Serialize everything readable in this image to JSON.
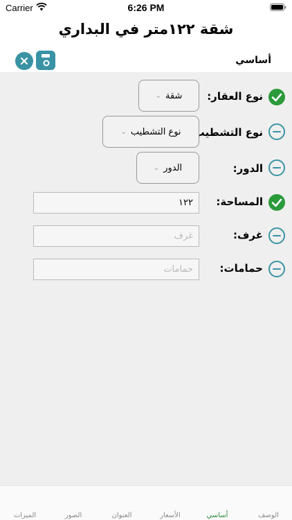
{
  "status": {
    "carrier": "Carrier",
    "time": "6:26 PM"
  },
  "title": "شقة ١٢٢متر في البداري",
  "toolbar": {
    "section_label": "أساسي"
  },
  "form": {
    "property_type": {
      "label": "نوع العقار:",
      "value": "شقة",
      "state": "ok"
    },
    "finishing_type": {
      "label": "نوع التشطيب:",
      "value": "نوع التشطيب",
      "state": "todo"
    },
    "floor": {
      "label": "الدور:",
      "value": "الدور",
      "state": "todo"
    },
    "area": {
      "label": "المساحة:",
      "value": "١٢٢",
      "state": "ok"
    },
    "rooms": {
      "label": "غرف:",
      "placeholder": "غرف",
      "state": "todo"
    },
    "bathrooms": {
      "label": "حمامات:",
      "placeholder": "حمامات",
      "state": "todo"
    }
  },
  "tabs": [
    {
      "label": "الوصف",
      "active": false
    },
    {
      "label": "أساسي",
      "active": true
    },
    {
      "label": "الأسعار",
      "active": false
    },
    {
      "label": "العنوان",
      "active": false
    },
    {
      "label": "الصور",
      "active": false
    },
    {
      "label": "الميزات",
      "active": false
    }
  ],
  "colors": {
    "accent": "#3a93a4",
    "ok": "#2a9a3b",
    "active_tab": "#2a8a3a",
    "form_bg": "#efefef"
  }
}
